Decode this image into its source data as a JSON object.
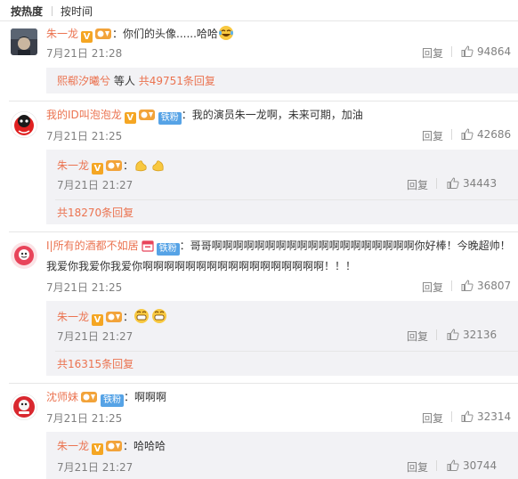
{
  "sort": {
    "hot": "按热度",
    "time": "按时间"
  },
  "ui": {
    "reply": "回复",
    "sep": "：",
    "exclaim": "！"
  },
  "colors": {
    "accent": "#eb7350",
    "badge_iron": "#56a3e6",
    "sub_bg": "#f2f2f5"
  },
  "comments": [
    {
      "user": "朱一龙",
      "text": "你们的头像......哈哈",
      "emoji": "laugh-tears-emoji",
      "time": "7月21日 21:28",
      "likes": "94864",
      "replies_summary": {
        "user": "熙郗汐曦兮",
        "text": "等人",
        "link": "共49751条回复"
      }
    },
    {
      "user": "我的ID叫泡泡龙",
      "badge": "铁粉",
      "text": "我的演员朱一龙啊，未来可期，加油",
      "time": "7月21日 21:25",
      "likes": "42686",
      "sub_reply": {
        "user": "朱一龙",
        "emoji": "flex-arms-emoji",
        "time": "7月21日 21:27",
        "likes": "34443"
      },
      "more": "共18270条回复"
    },
    {
      "user": "I|所有的酒都不如居",
      "badge": "铁粉",
      "text_line1": "哥哥啊啊啊啊啊啊啊啊啊啊啊啊啊啊啊啊啊啊啊你好棒！今晚超帅",
      "text_line2": "我爱你我爱你我爱你啊啊啊啊啊啊啊啊啊啊啊啊啊啊啊啊啊！！！",
      "time": "7月21日 21:25",
      "likes": "36807",
      "sub_reply": {
        "user": "朱一龙",
        "emoji": "grin-emoji",
        "time": "7月21日 21:27",
        "likes": "32136"
      },
      "more": "共16315条回复"
    },
    {
      "user": "沈师妹",
      "badge": "铁粉",
      "text": "啊啊啊",
      "time": "7月21日 21:25",
      "likes": "32314",
      "sub_reply": {
        "user": "朱一龙",
        "text": "哈哈哈",
        "time": "7月21日 21:27",
        "likes": "30744"
      }
    }
  ]
}
